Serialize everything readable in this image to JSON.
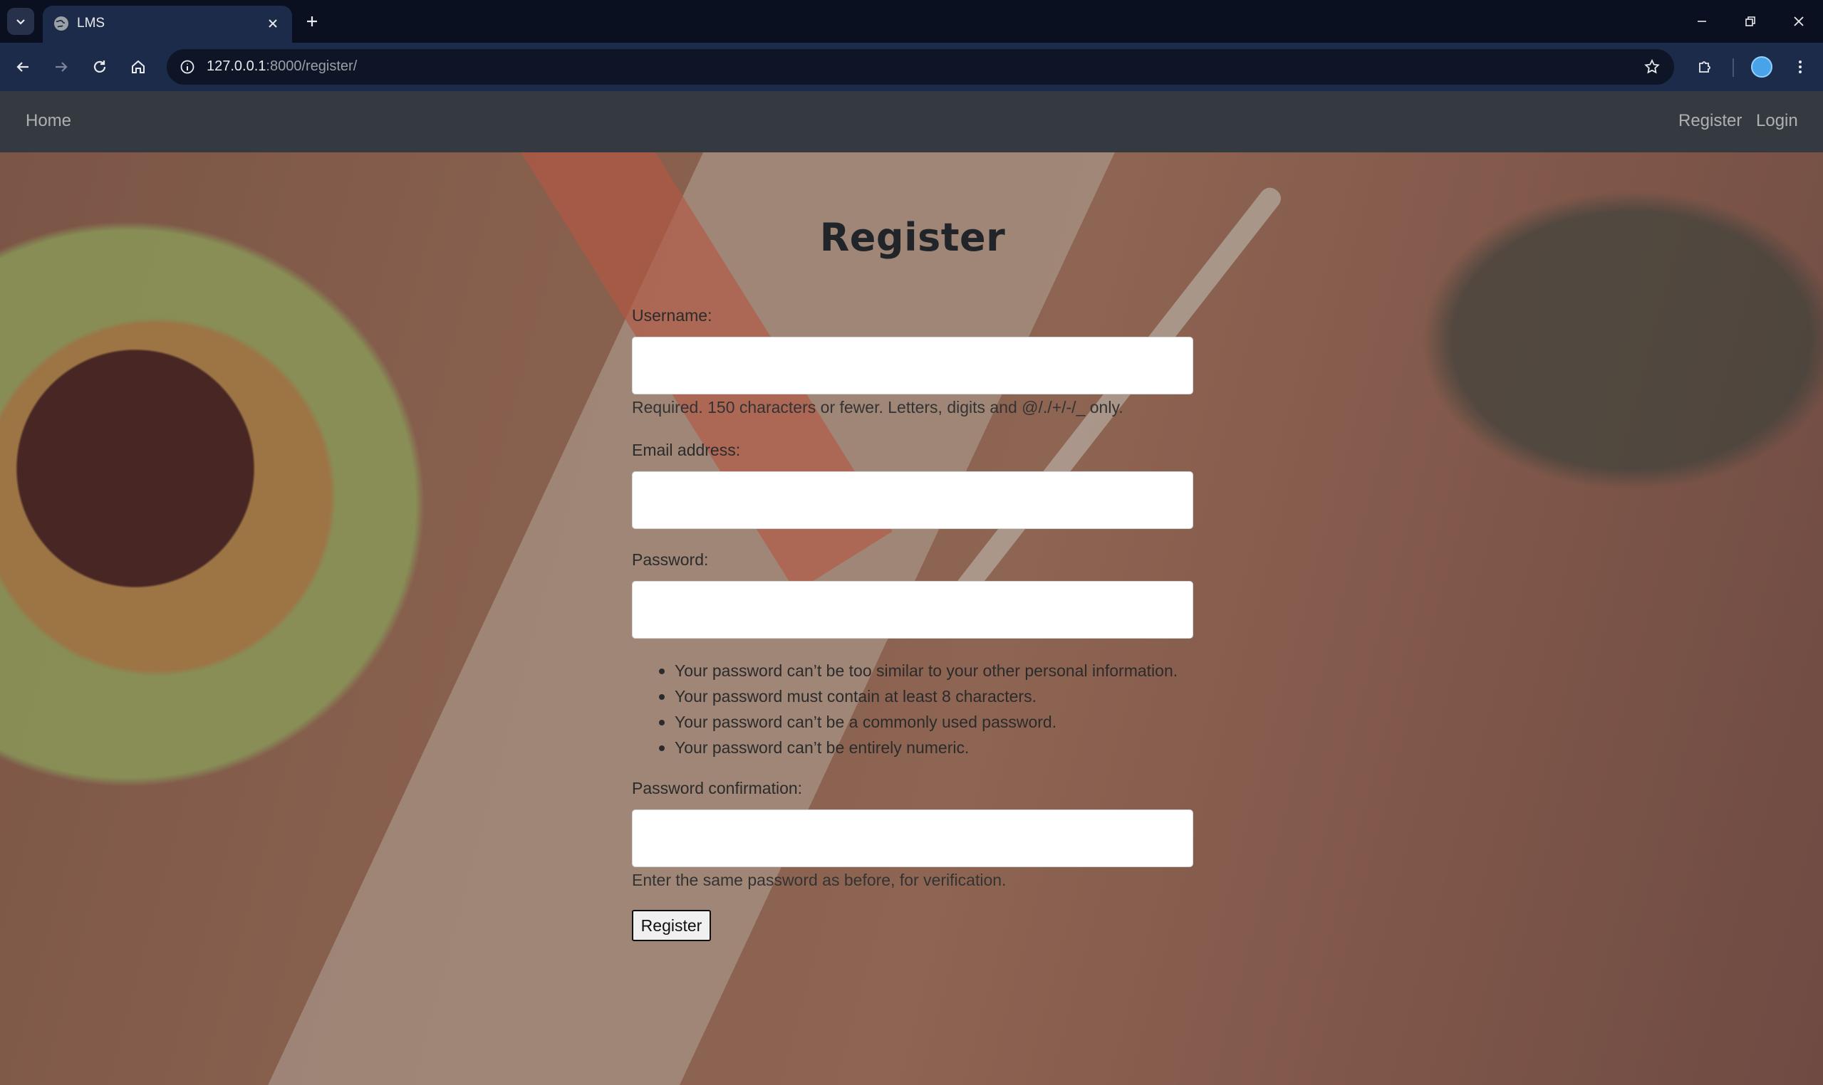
{
  "browser": {
    "tab_title": "LMS",
    "url_host": "127.0.0.1",
    "url_path": ":8000/register/"
  },
  "navbar": {
    "home": "Home",
    "register": "Register",
    "login": "Login"
  },
  "form": {
    "title": "Register",
    "username_label": "Username:",
    "username_value": "",
    "username_help": "Required. 150 characters or fewer. Letters, digits and @/./+/-/_ only.",
    "email_label": "Email address:",
    "email_value": "",
    "password_label": "Password:",
    "password_value": "",
    "password_rules": [
      "Your password can’t be too similar to your other personal information.",
      "Your password must contain at least 8 characters.",
      "Your password can’t be a commonly used password.",
      "Your password can’t be entirely numeric."
    ],
    "password2_label": "Password confirmation:",
    "password2_value": "",
    "password2_help": "Enter the same password as before, for verification.",
    "submit_label": "Register"
  },
  "colors": {
    "navbar_bg": "#343a40",
    "chrome_bg": "#1d2b4a",
    "tabstrip_bg": "#0b1020"
  }
}
